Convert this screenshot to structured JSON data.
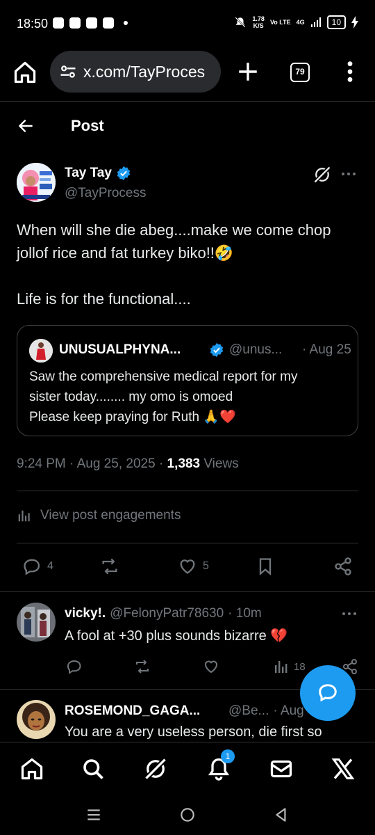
{
  "status_bar": {
    "time": "18:50",
    "net_speed": "1.78",
    "net_unit": "K/S",
    "volte": "Vo LTE",
    "signal": "4G",
    "battery": "10"
  },
  "browser": {
    "url": "x.com/TayProces",
    "tab_count": "79"
  },
  "header": {
    "title": "Post"
  },
  "post": {
    "author_name": "Tay Tay",
    "author_handle": "@TayProcess",
    "text_lines": [
      "When will she die abeg....make we come chop jollof rice and fat turkey biko!!🤣",
      "Life is for the functional...."
    ],
    "timestamp": "9:24 PM · Aug 25, 2025 · ",
    "views_count": "1,383",
    "views_label": " Views",
    "engagements_label": "View post engagements",
    "replies": "4",
    "likes": "5"
  },
  "quote": {
    "name": "UNUSUALPHYNA...",
    "handle": "@unus...",
    "time": "· Aug 25",
    "text_lines": [
      "Saw the comprehensive medical report for my",
      "sister today........ my omo is omoed",
      "Please keep praying for Ruth 🙏❤️"
    ]
  },
  "replies": [
    {
      "name": "vicky!.",
      "handle": "@FelonyPatr78630",
      "time": "· 10m",
      "text": "A fool at +30 plus sounds bizarre 💔",
      "views": "18"
    },
    {
      "name": "ROSEMOND_GAGA...",
      "handle": "@Be...",
      "time": "· Aug",
      "text": "You are a very useless person, die first so"
    }
  ],
  "nav": {
    "notification_badge": "1"
  },
  "colors": {
    "accent": "#1d9bf0",
    "background": "#000000",
    "muted": "#71767b"
  }
}
